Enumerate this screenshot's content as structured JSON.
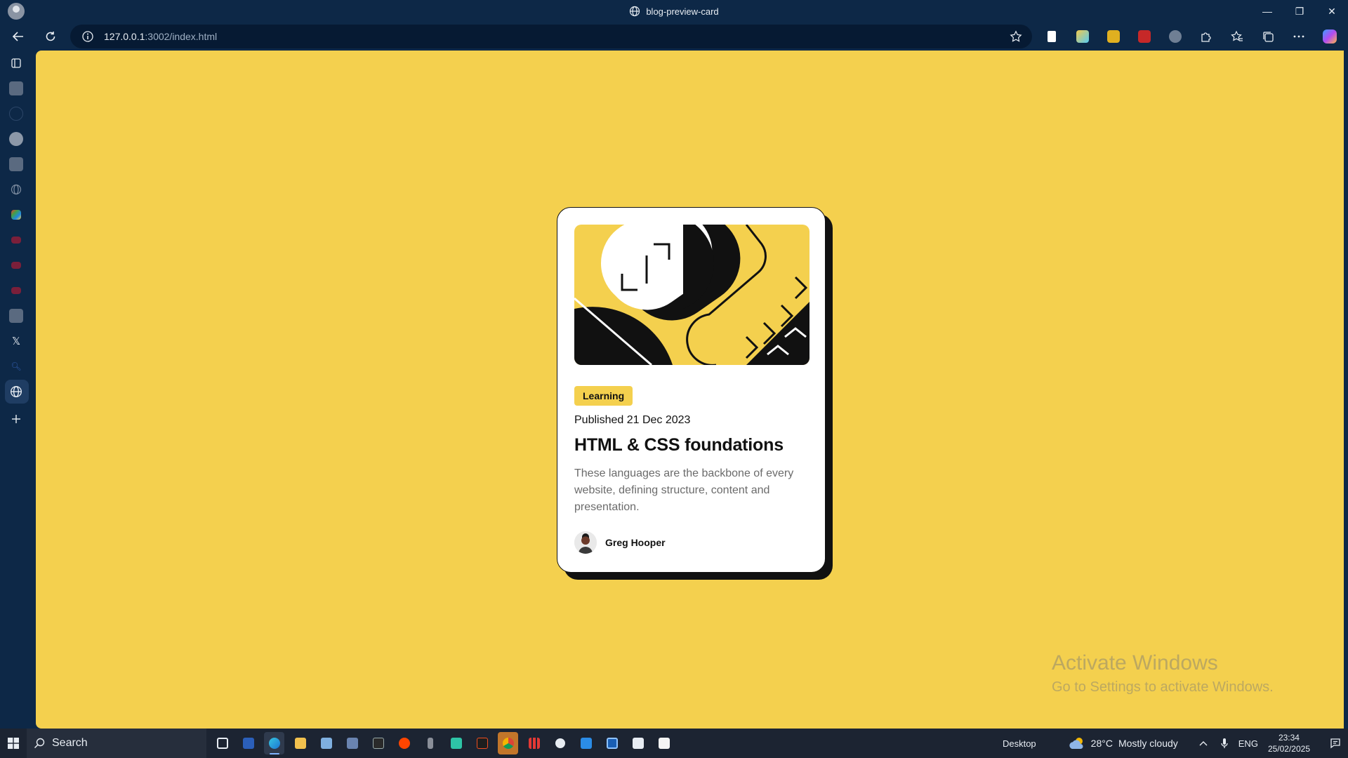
{
  "window": {
    "tab_title": "blog-preview-card",
    "controls": {
      "minimize": "—",
      "restore": "❐",
      "close": "✕"
    }
  },
  "toolbar": {
    "url_host": "127.0.0.1",
    "url_path": ":3002/index.html",
    "extensions": [
      "reading-list-icon",
      "copilot-ext-icon",
      "clapper-icon",
      "acrobat-icon",
      "shield-icon",
      "puzzle-icon",
      "favorites-icon",
      "collections-icon",
      "more-icon",
      "copilot-icon"
    ]
  },
  "sidebar": {
    "items": [
      "tabs-icon",
      "site-icon",
      "circle-icon",
      "github-icon",
      "site-icon",
      "globe-icon",
      "apps-icon",
      "youtube-icon",
      "youtube-icon",
      "youtube-icon",
      "site-icon",
      "x-icon",
      "search-icon",
      "globe-icon",
      "add-icon"
    ]
  },
  "card": {
    "tag": "Learning",
    "published": "Published 21 Dec 2023",
    "title": "HTML & CSS foundations",
    "description": "These languages are the backbone of every website, defining structure, content and presentation.",
    "author": "Greg Hooper"
  },
  "watermark": {
    "line1": "Activate Windows",
    "line2": "Go to Settings to activate Windows."
  },
  "taskbar": {
    "search_label": "Search",
    "desktop_label": "Desktop",
    "weather_temp": "28°C",
    "weather_text": "Mostly cloudy",
    "language": "ENG",
    "time": "23:34",
    "date": "25/02/2025"
  },
  "colors": {
    "page_bg": "#f4d04e",
    "chrome_bg": "#0d2847",
    "taskbar_bg": "#1c2432",
    "card_text": "#111111",
    "card_muted": "#6b6b6b"
  }
}
